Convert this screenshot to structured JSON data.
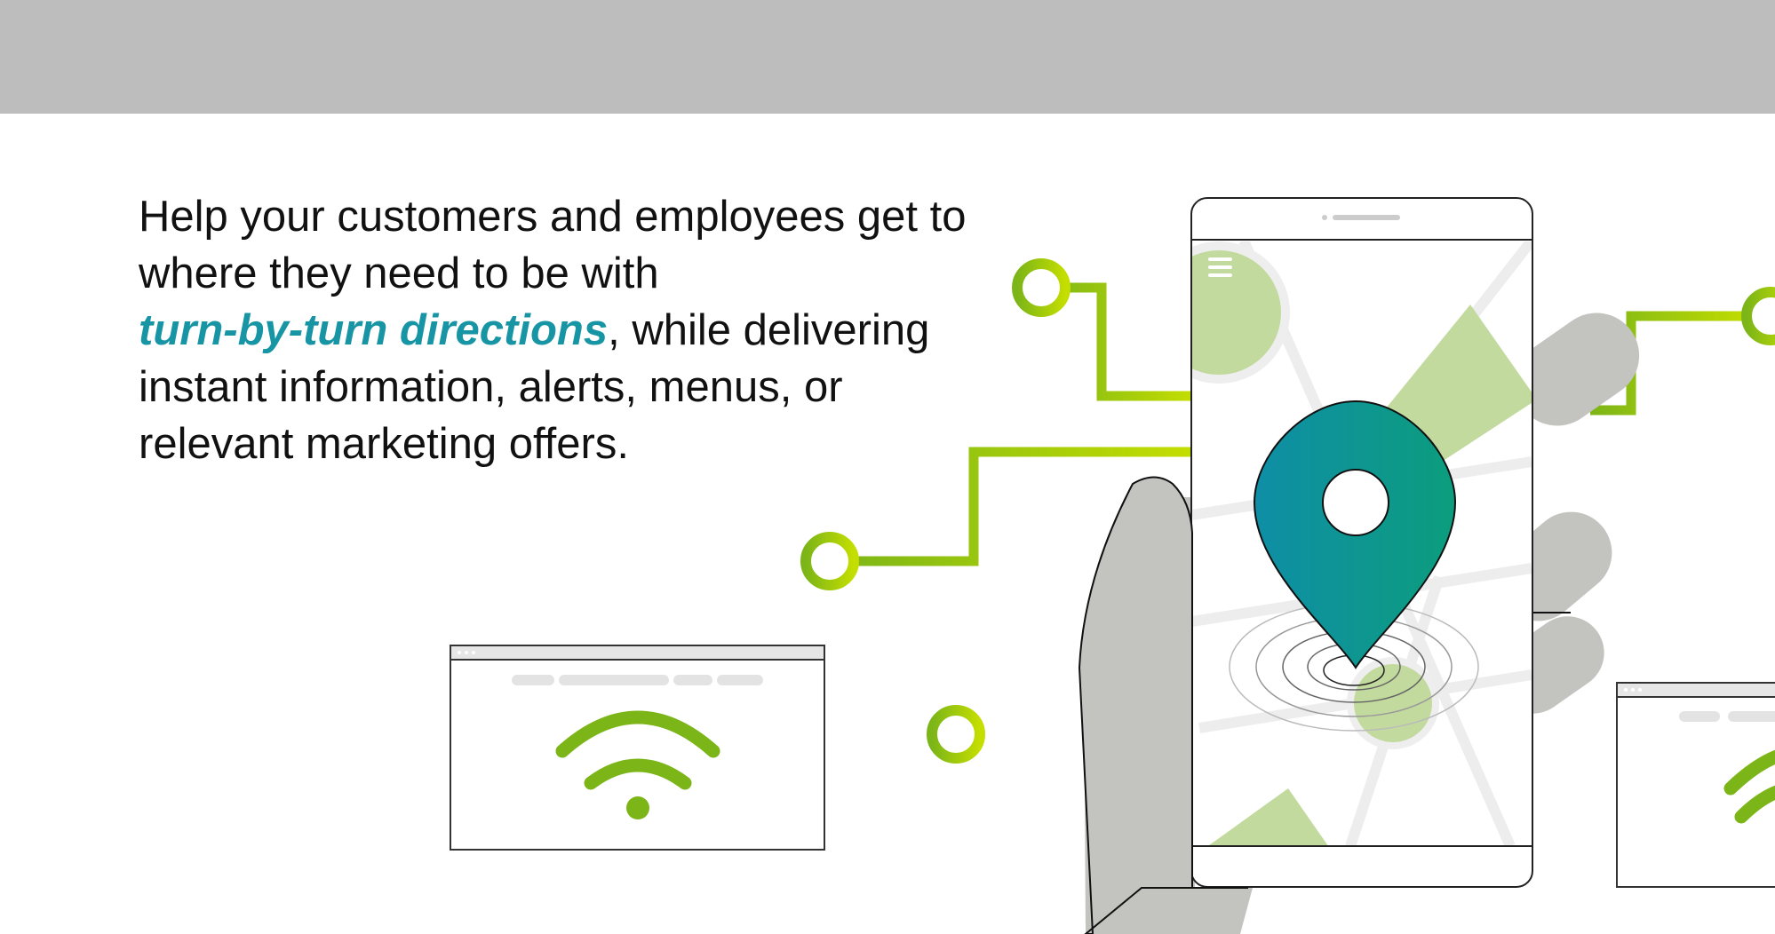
{
  "intro": {
    "line1": "Help your customers and employees get to",
    "line2": "where they need to be with",
    "highlight": "turn-by-turn directions",
    "line3_rest": ", while delivering",
    "line4": "instant information, alerts, menus, or",
    "line5": "relevant marketing offers."
  },
  "colors": {
    "banner": "#bdbdbd",
    "highlight_text": "#1795a5",
    "circuit_green": "#7cb518",
    "circuit_lime": "#c4de00",
    "map_green": "#c2da9e",
    "hand_gray": "#c3c3c0",
    "pin_start": "#0f8ea6",
    "pin_end": "#0c9d7d"
  },
  "icons": {
    "wifi": "wifi-icon",
    "location_pin": "map-pin-icon",
    "menu": "hamburger-menu-icon"
  }
}
